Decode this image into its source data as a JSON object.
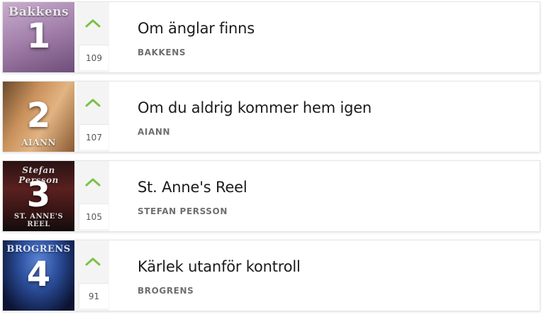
{
  "chart": {
    "entries": [
      {
        "rank": "1",
        "title": "Om änglar finns",
        "artist": "BAKKENS",
        "votes": "109",
        "cover_caption": "Bakkens",
        "cover_colors": [
          "#b797bd",
          "#7a5a86"
        ]
      },
      {
        "rank": "2",
        "title": "Om du aldrig kommer hem igen",
        "artist": "AIANN",
        "votes": "107",
        "cover_caption": "AIANN",
        "cover_colors": [
          "#d8a06e",
          "#7a4e2a"
        ]
      },
      {
        "rank": "3",
        "title": "St. Anne's Reel",
        "artist": "STEFAN PERSSON",
        "votes": "105",
        "cover_caption": "Stefan Persson",
        "cover_caption_bottom": "ST. ANNE'S REEL",
        "cover_colors": [
          "#5b2323",
          "#151010"
        ]
      },
      {
        "rank": "4",
        "title": "Kärlek utanför kontroll",
        "artist": "BROGRENS",
        "votes": "91",
        "cover_caption": "BROGRENS",
        "cover_colors": [
          "#2b4d9a",
          "#0b1433"
        ]
      }
    ],
    "accent_color": "#7cc243"
  }
}
